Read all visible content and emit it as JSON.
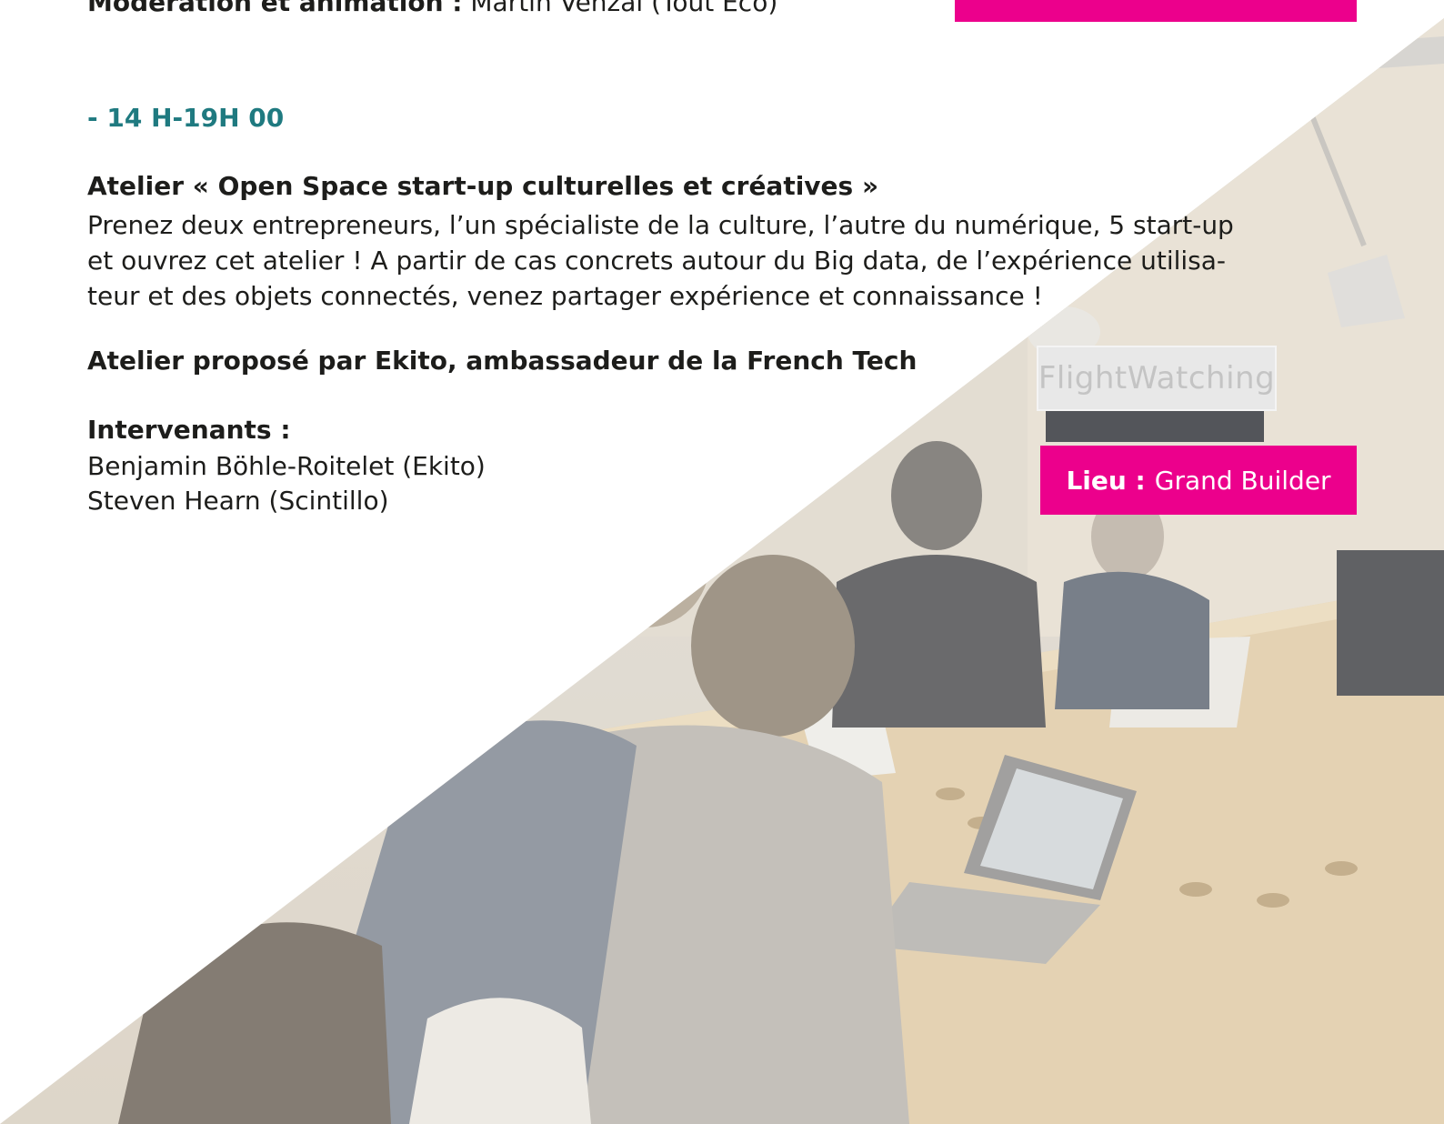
{
  "top": {
    "moderation_label": "Modération et animation :",
    "moderation_value": "Martin Venzal (Tout Eco)"
  },
  "session": {
    "time": "- 14 H-19H 00",
    "title": "Atelier « Open Space start-up culturelles et créatives »",
    "description_lines": [
      "Prenez deux entrepreneurs, l’un spécialiste de la culture, l’autre du numérique, 5 start-up",
      "et ouvrez cet atelier ! A partir de cas concrets autour du  Big data, de l’expérience utilisa-",
      "teur et des objets connectés, venez partager expérience et connaissance !"
    ],
    "organizer": "Atelier proposé par Ekito, ambassadeur de la French Tech",
    "speakers_heading": "Intervenants :",
    "speakers": [
      "Benjamin Böhle-Roitelet (Ekito)",
      "Steven Hearn (Scintillo)"
    ],
    "venue_label": "Lieu :",
    "venue_value": "Grand Builder"
  },
  "photo": {
    "sign_text": "FlightWatching"
  },
  "colors": {
    "accent_pink": "#ec008c",
    "time_teal": "#1f7a80",
    "text": "#1d1d1b"
  }
}
